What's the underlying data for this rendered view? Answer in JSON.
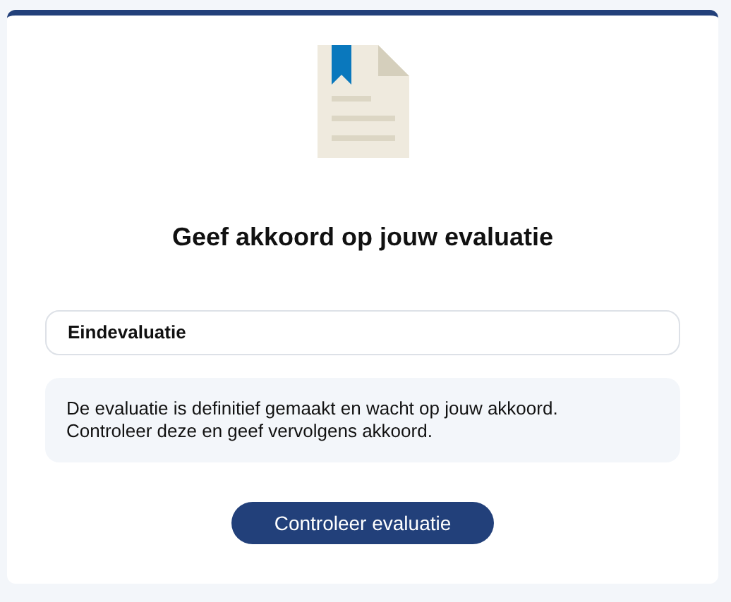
{
  "title": "Geef akkoord op jouw evaluatie",
  "item": {
    "label": "Eindevaluatie"
  },
  "message": {
    "lines": [
      "De evaluatie is definitief gemaakt en wacht op jouw akkoord.",
      "Controleer deze en geef vervolgens akkoord."
    ]
  },
  "button": {
    "label": "Controleer evaluatie"
  }
}
